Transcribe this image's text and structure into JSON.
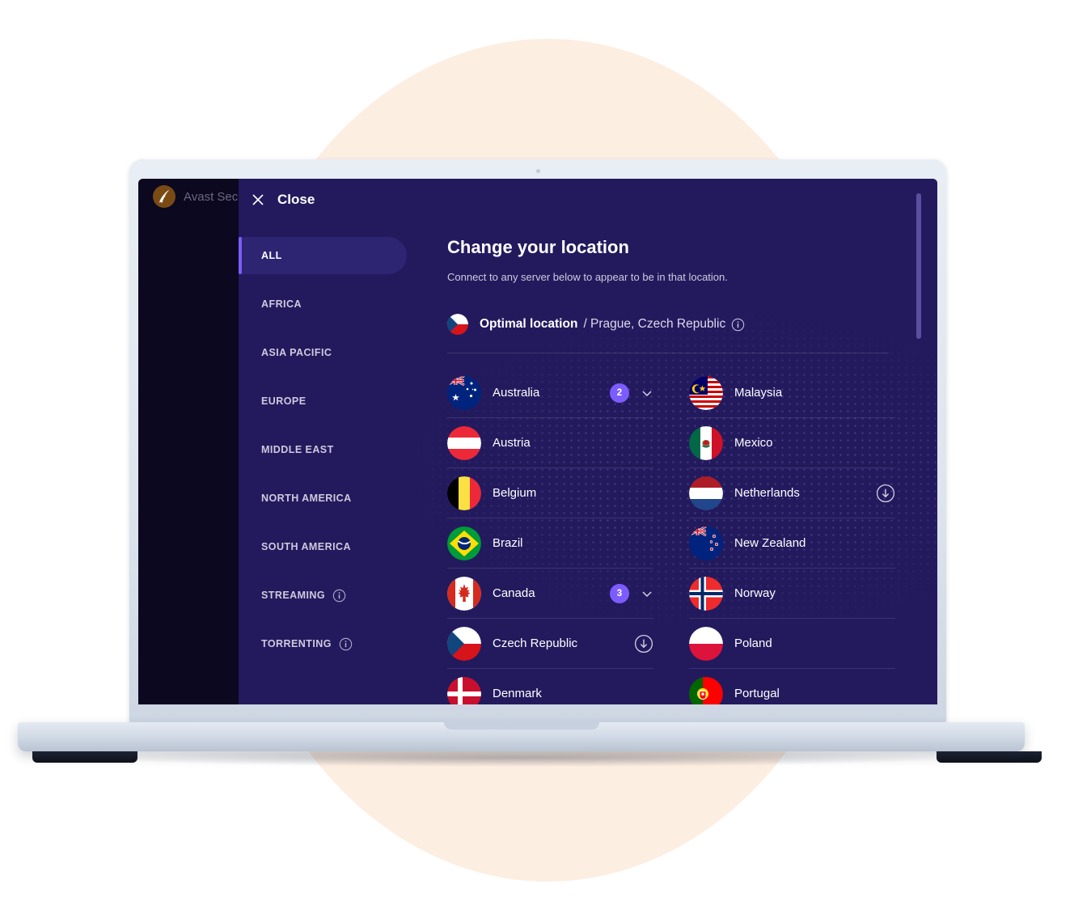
{
  "app": {
    "title": "Avast Secu",
    "logo_color": "#7a4a15"
  },
  "panel": {
    "close_label": "Close"
  },
  "sidebar": {
    "items": [
      {
        "label": "ALL",
        "active": true,
        "info": false
      },
      {
        "label": "AFRICA",
        "active": false,
        "info": false
      },
      {
        "label": "ASIA PACIFIC",
        "active": false,
        "info": false
      },
      {
        "label": "EUROPE",
        "active": false,
        "info": false
      },
      {
        "label": "MIDDLE EAST",
        "active": false,
        "info": false
      },
      {
        "label": "NORTH AMERICA",
        "active": false,
        "info": false
      },
      {
        "label": "SOUTH AMERICA",
        "active": false,
        "info": false
      },
      {
        "label": "STREAMING",
        "active": false,
        "info": true
      },
      {
        "label": "TORRENTING",
        "active": false,
        "info": true
      }
    ]
  },
  "content": {
    "title": "Change your location",
    "subtitle": "Connect to any server below to appear to be in that location.",
    "optimal": {
      "strong": "Optimal location",
      "rest": "/ Prague, Czech Republic",
      "flag": "cz",
      "info": true
    },
    "columns": [
      [
        {
          "name": "Australia",
          "flag": "au",
          "badge": "2",
          "chevron": true,
          "download": false
        },
        {
          "name": "Austria",
          "flag": "at",
          "badge": null,
          "chevron": false,
          "download": false
        },
        {
          "name": "Belgium",
          "flag": "be",
          "badge": null,
          "chevron": false,
          "download": false
        },
        {
          "name": "Brazil",
          "flag": "br",
          "badge": null,
          "chevron": false,
          "download": false
        },
        {
          "name": "Canada",
          "flag": "ca",
          "badge": "3",
          "chevron": true,
          "download": false
        },
        {
          "name": "Czech Republic",
          "flag": "cz",
          "badge": null,
          "chevron": false,
          "download": true
        },
        {
          "name": "Denmark",
          "flag": "dk",
          "badge": null,
          "chevron": false,
          "download": false
        }
      ],
      [
        {
          "name": "Malaysia",
          "flag": "my",
          "badge": null,
          "chevron": false,
          "download": false
        },
        {
          "name": "Mexico",
          "flag": "mx",
          "badge": null,
          "chevron": false,
          "download": false
        },
        {
          "name": "Netherlands",
          "flag": "nl",
          "badge": null,
          "chevron": false,
          "download": true
        },
        {
          "name": "New Zealand",
          "flag": "nz",
          "badge": null,
          "chevron": false,
          "download": false
        },
        {
          "name": "Norway",
          "flag": "no",
          "badge": null,
          "chevron": false,
          "download": false
        },
        {
          "name": "Poland",
          "flag": "pl",
          "badge": null,
          "chevron": false,
          "download": false
        },
        {
          "name": "Portugal",
          "flag": "pt",
          "badge": null,
          "chevron": false,
          "download": false
        }
      ]
    ]
  },
  "colors": {
    "panel_bg": "#231a5e",
    "app_bg": "#0b0820",
    "accent": "#7c5cff",
    "blob": "#fdeee2",
    "laptop": "#dde4ee"
  }
}
